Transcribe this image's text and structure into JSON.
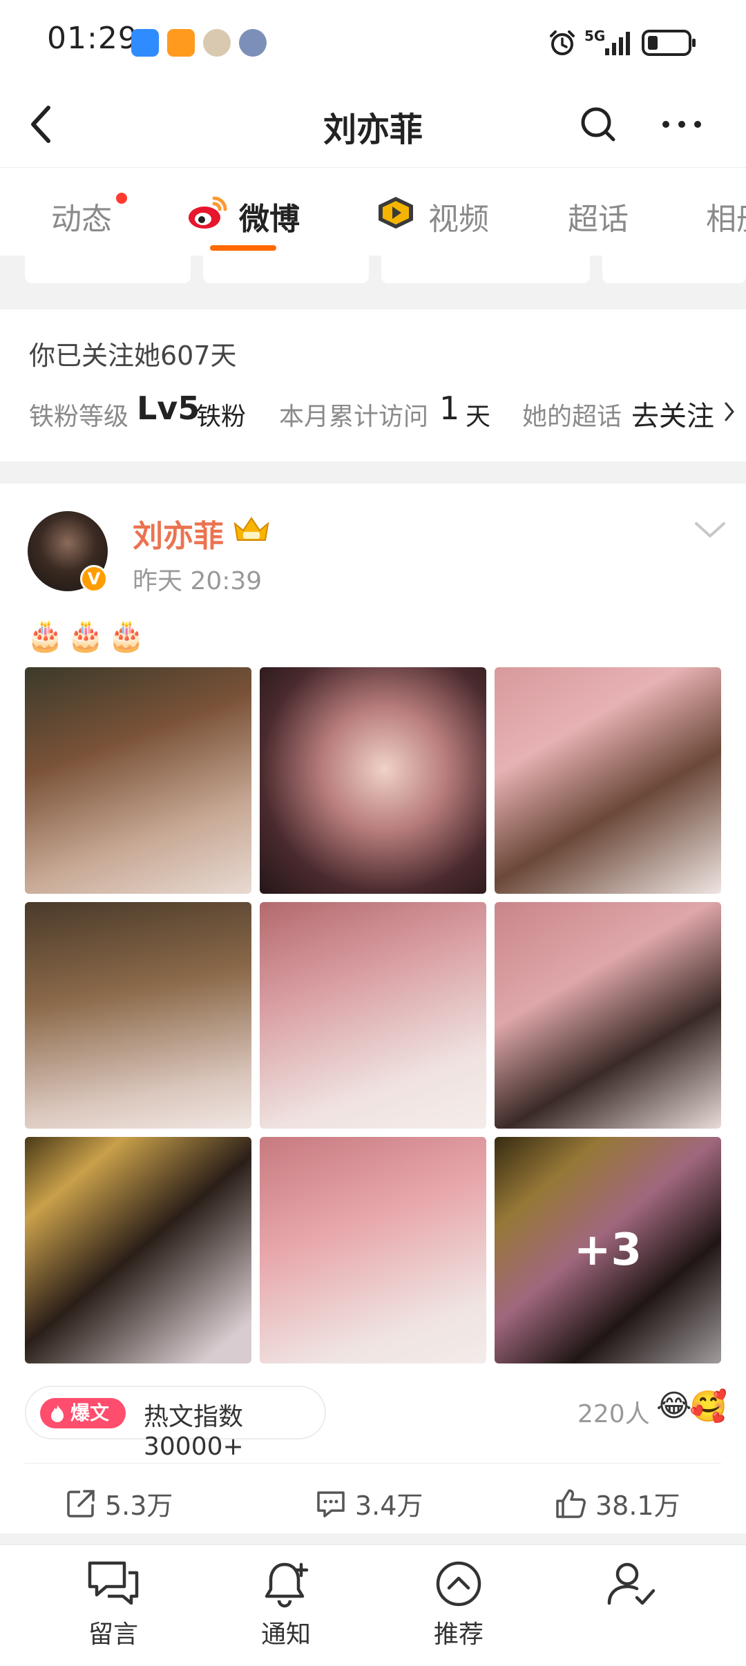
{
  "status_bar": {
    "time": "01:29",
    "network": "5G"
  },
  "nav": {
    "title": "刘亦菲"
  },
  "tabs": [
    {
      "label": "动态",
      "badge": true
    },
    {
      "label": "微博",
      "active": true
    },
    {
      "label": "视频"
    },
    {
      "label": "超话"
    },
    {
      "label": "相册"
    }
  ],
  "fan_info": {
    "follow_days": "你已关注她607天",
    "fan_level_label": "铁粉等级",
    "fan_level": "Lv5",
    "fan_level_suffix": "铁粉",
    "visit_label": "本月累计访问",
    "visit_count": "1",
    "visit_unit": "天",
    "supertopic_label": "她的超话",
    "supertopic_action": "去关注"
  },
  "post": {
    "author": "刘亦菲",
    "time": "昨天 20:39",
    "text": "🎂🎂🎂",
    "photos_extra": "+3",
    "hot_badge": "爆文",
    "hot_text": "热文指数30000+",
    "reactors": "220人",
    "actions": {
      "share": "5.3万",
      "comment": "3.4万",
      "like": "38.1万"
    }
  },
  "bottom_bar": [
    {
      "label": "留言",
      "icon": "message-icon"
    },
    {
      "label": "通知",
      "icon": "bell-plus-icon"
    },
    {
      "label": "推荐",
      "icon": "recommend-icon"
    },
    {
      "label": "",
      "icon": "user-check-icon"
    }
  ],
  "colors": {
    "accent": "#ff6a00",
    "author": "#eb7350",
    "hot_badge": "#ff4d6d"
  }
}
